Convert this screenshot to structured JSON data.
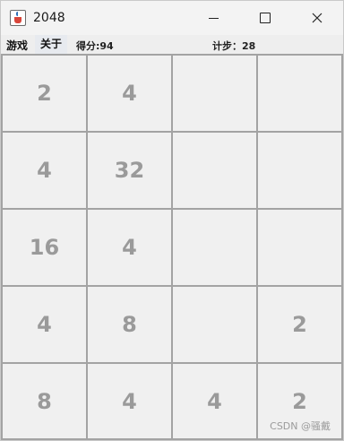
{
  "window": {
    "title": "2048"
  },
  "titlebar": {
    "minimize_icon": "minimize-icon",
    "maximize_icon": "maximize-icon",
    "close_icon": "close-icon"
  },
  "menu": {
    "items": [
      {
        "label": "游戏"
      },
      {
        "label": "关于"
      }
    ]
  },
  "status": {
    "score_label": "得分:94",
    "steps_label": "计步：28"
  },
  "board": {
    "rows": [
      [
        "2",
        "4",
        "",
        ""
      ],
      [
        "4",
        "32",
        "",
        ""
      ],
      [
        "16",
        "4",
        "",
        ""
      ],
      [
        "4",
        "8",
        "",
        "2"
      ],
      [
        "8",
        "4",
        "4",
        "2"
      ]
    ]
  },
  "watermark": "CSDN @骚戴",
  "colors": {
    "tile_text": "#9a9a9a",
    "tile_border": "#a3a3a3",
    "background": "#f0f0f0"
  }
}
